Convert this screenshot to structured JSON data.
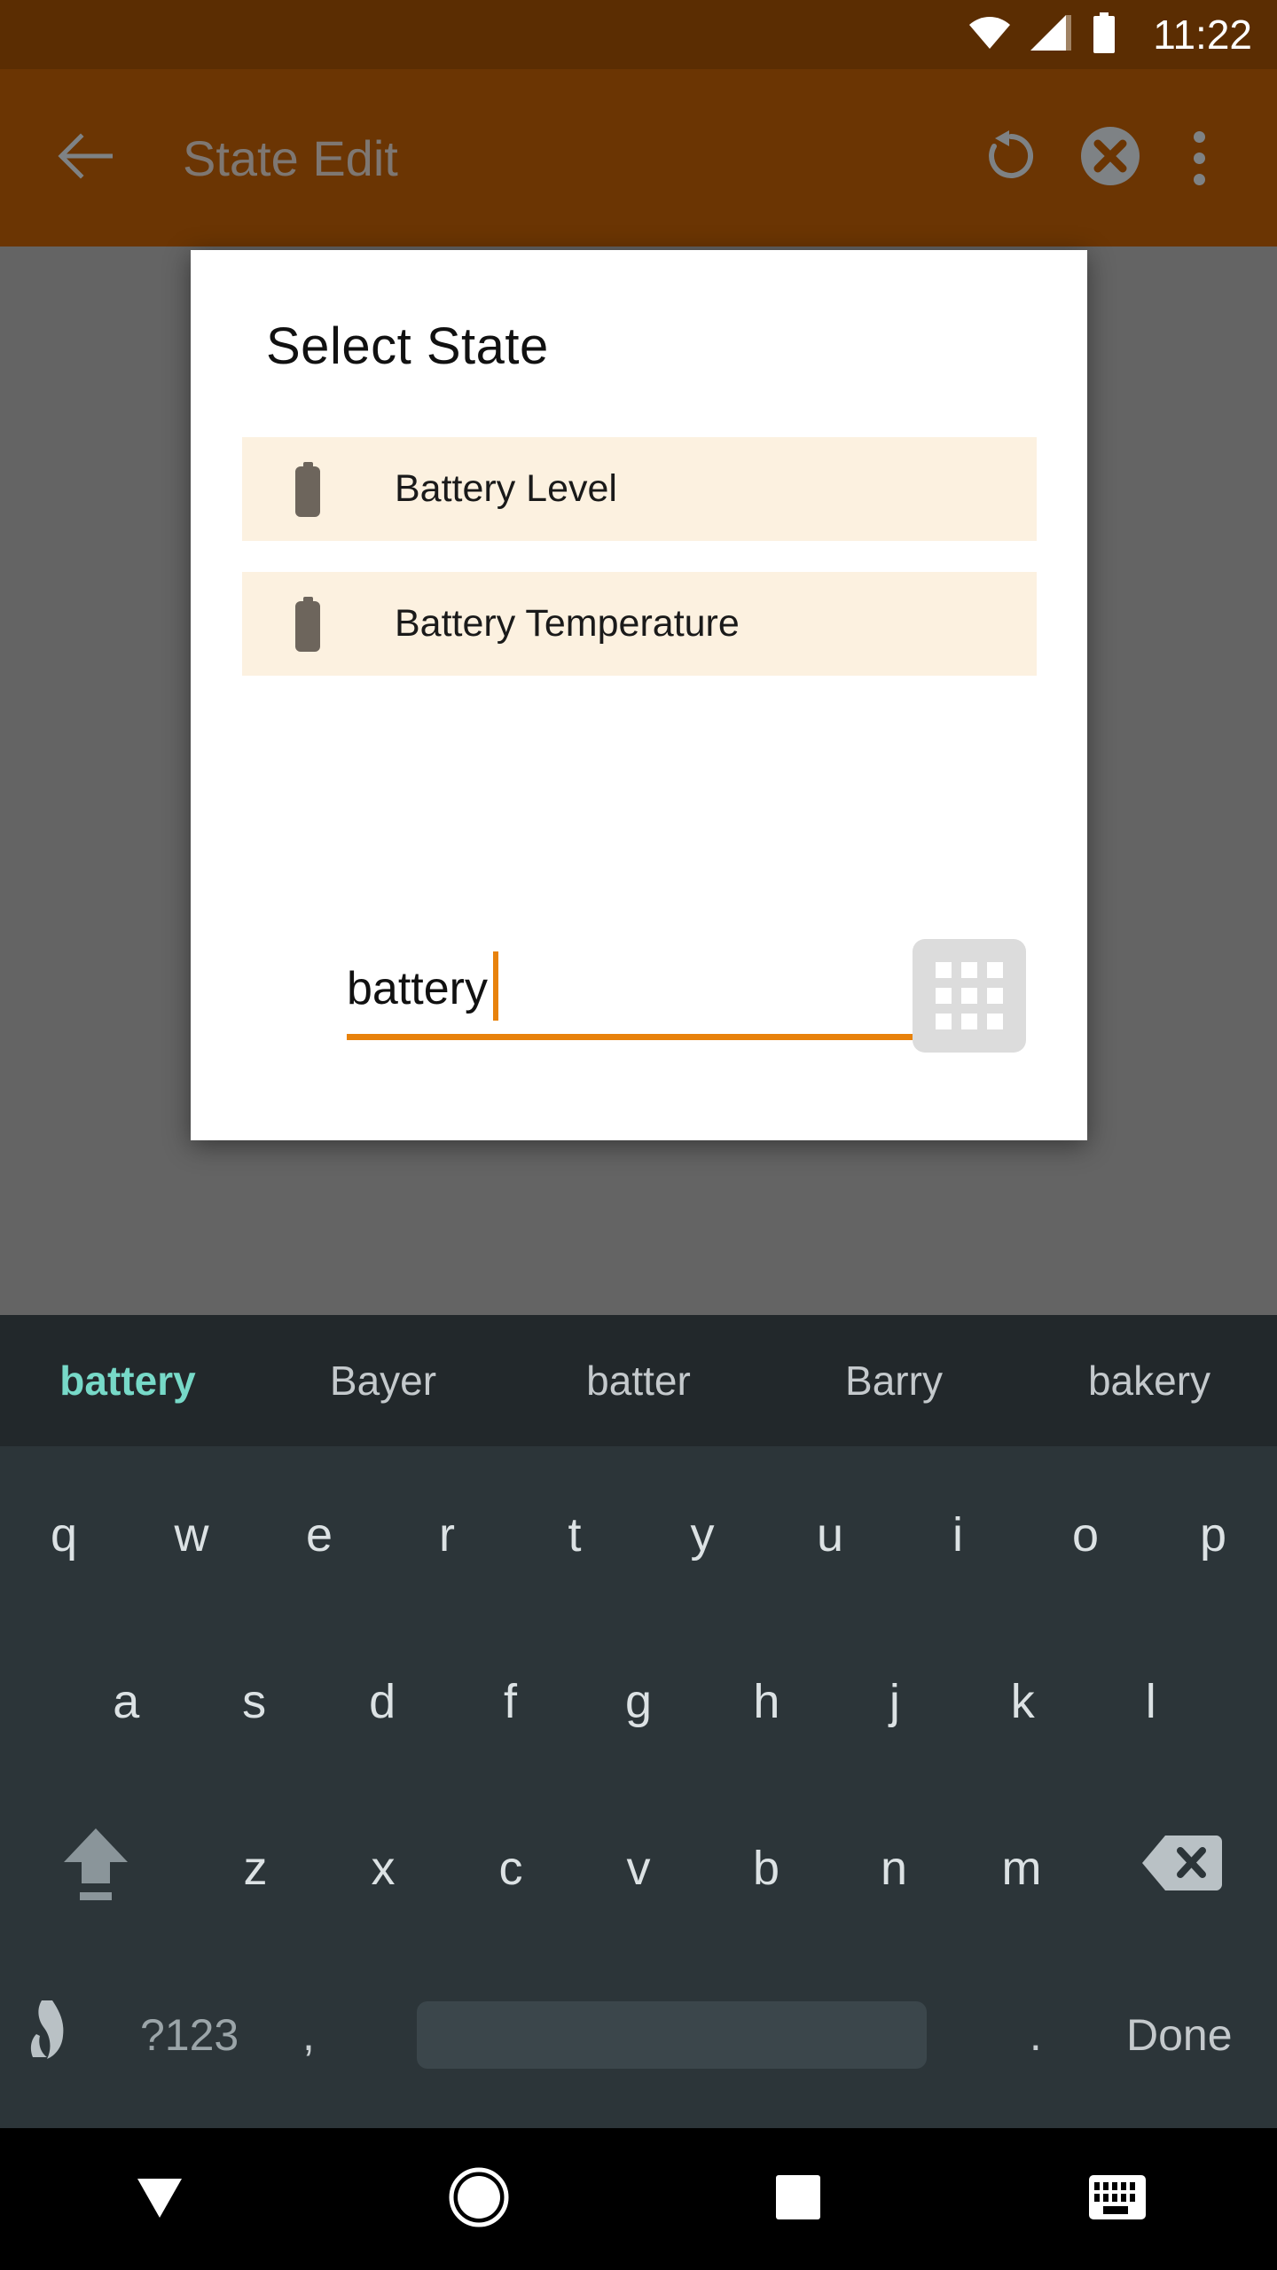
{
  "status_bar": {
    "clock": "11:22",
    "icons": [
      "wifi-icon",
      "cell-signal-icon",
      "battery-icon"
    ]
  },
  "app_bar": {
    "title": "State Edit",
    "back_icon": "back-arrow-icon",
    "actions": [
      {
        "name": "undo-button",
        "icon": "undo-rotate-icon"
      },
      {
        "name": "clear-button",
        "icon": "circle-x-icon"
      },
      {
        "name": "overflow-menu-button",
        "icon": "three-dots-icon"
      }
    ]
  },
  "dialog": {
    "title": "Select  State",
    "items": [
      {
        "icon": "battery-icon",
        "label": "Battery Level"
      },
      {
        "icon": "battery-icon",
        "label": "Battery Temperature"
      }
    ],
    "search": {
      "value": "battery",
      "placeholder": "",
      "grid_button_icon": "apps-grid-icon"
    }
  },
  "keyboard": {
    "suggestions": [
      "battery",
      "Bayer",
      "batter",
      "Barry",
      "bakery"
    ],
    "active_suggestion_index": 0,
    "row1": [
      "q",
      "w",
      "e",
      "r",
      "t",
      "y",
      "u",
      "i",
      "o",
      "p"
    ],
    "row2": [
      "a",
      "s",
      "d",
      "f",
      "g",
      "h",
      "j",
      "k",
      "l"
    ],
    "row3": [
      "z",
      "x",
      "c",
      "v",
      "b",
      "n",
      "m"
    ],
    "shift_icon": "shift-arrow-icon",
    "backspace_icon": "backspace-icon",
    "emoji_icon": "emoji-language-icon",
    "symbols_label": "?123",
    "comma_label": ",",
    "period_label": ".",
    "space_label": "",
    "done_label": "Done"
  },
  "nav_bar": {
    "buttons": [
      {
        "name": "nav-back-button",
        "icon": "down-triangle-icon"
      },
      {
        "name": "nav-home-button",
        "icon": "circle-icon"
      },
      {
        "name": "nav-recents-button",
        "icon": "square-icon"
      },
      {
        "name": "nav-keyboard-button",
        "icon": "keyboard-icon"
      }
    ]
  },
  "colors": {
    "status_bar": "#5B2D02",
    "app_bar": "#6B3503",
    "scrim": "#646464",
    "dialog_bg": "#FFFFFF",
    "list_item_bg": "#FCF1E0",
    "accent_orange": "#E8820C",
    "keyboard_bg": "#2C3539",
    "suggestion_bg": "#22282B",
    "suggestion_active": "#77D9C8",
    "nav_bar": "#000000"
  }
}
